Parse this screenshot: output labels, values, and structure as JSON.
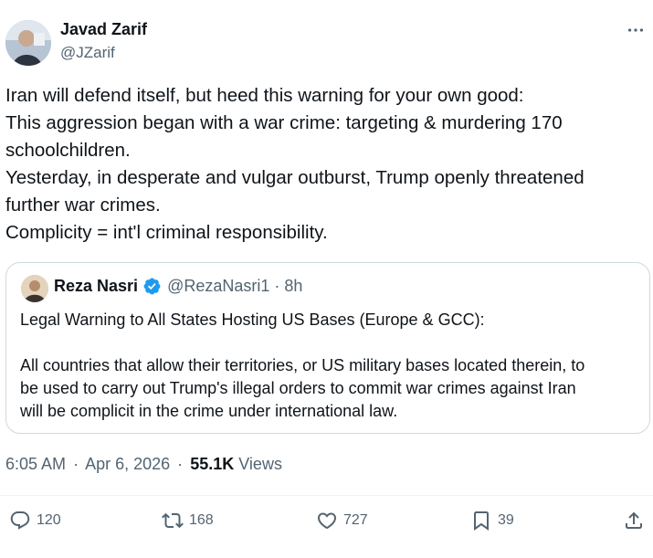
{
  "tweet": {
    "author_name": "Javad Zarif",
    "author_handle": "@JZarif",
    "text_lines": [
      "Iran will defend itself, but heed this warning for your own good:",
      "This aggression began with a war crime: targeting & murdering 170",
      "schoolchildren.",
      "Yesterday, in desperate and vulgar outburst, Trump openly threatened",
      "further war crimes.",
      "Complicity = int'l criminal responsibility."
    ],
    "time": "6:05 AM",
    "date": "Apr 6, 2026",
    "views_count": "55.1K",
    "views_label": "Views",
    "separator": "·"
  },
  "quote": {
    "author_name": "Reza Nasri",
    "author_handle": "@RezaNasri1",
    "separator": "·",
    "time": "8h",
    "text_lines": [
      "Legal Warning to All States Hosting US Bases (Europe & GCC):",
      "",
      "All countries that allow their territories, or US military bases located therein, to",
      "be used to carry out Trump's illegal orders to commit war crimes against Iran",
      "will be complicit in the crime under international law."
    ]
  },
  "actions": {
    "replies": "120",
    "reposts": "168",
    "likes": "727",
    "bookmarks": "39"
  },
  "icons": {
    "more": "more-icon",
    "verified": "verified-badge-icon",
    "reply": "reply-icon",
    "repost": "repost-icon",
    "like": "heart-icon",
    "bookmark": "bookmark-icon",
    "share": "share-icon"
  },
  "colors": {
    "text": "#0f1419",
    "secondary": "#536471",
    "verified": "#1d9bf0",
    "border": "#cfd9de"
  }
}
